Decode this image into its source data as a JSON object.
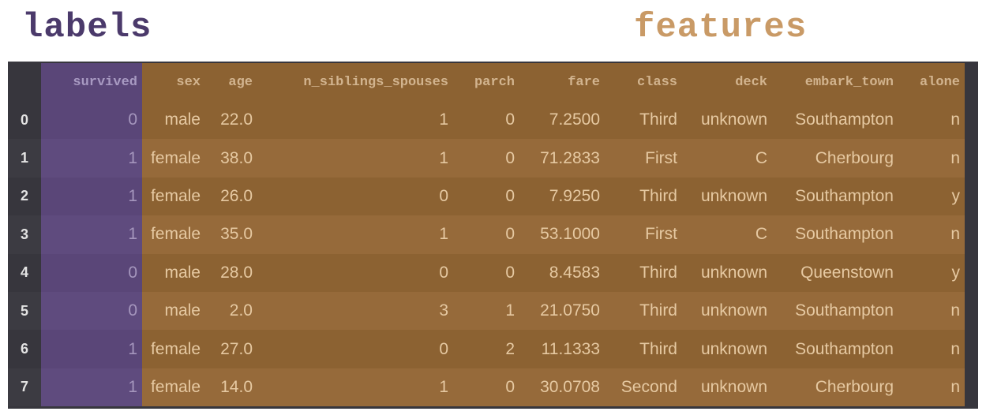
{
  "titles": {
    "labels": "labels",
    "features": "features"
  },
  "columns": {
    "index": "",
    "survived": "survived",
    "sex": "sex",
    "age": "age",
    "n_siblings_spouses": "n_siblings_spouses",
    "parch": "parch",
    "fare": "fare",
    "class": "class",
    "deck": "deck",
    "embark_town": "embark_town",
    "alone": "alone"
  },
  "rows": [
    {
      "index": "0",
      "survived": "0",
      "sex": "male",
      "age": "22.0",
      "n_siblings_spouses": "1",
      "parch": "0",
      "fare": "7.2500",
      "class": "Third",
      "deck": "unknown",
      "embark_town": "Southampton",
      "alone": "n"
    },
    {
      "index": "1",
      "survived": "1",
      "sex": "female",
      "age": "38.0",
      "n_siblings_spouses": "1",
      "parch": "0",
      "fare": "71.2833",
      "class": "First",
      "deck": "C",
      "embark_town": "Cherbourg",
      "alone": "n"
    },
    {
      "index": "2",
      "survived": "1",
      "sex": "female",
      "age": "26.0",
      "n_siblings_spouses": "0",
      "parch": "0",
      "fare": "7.9250",
      "class": "Third",
      "deck": "unknown",
      "embark_town": "Southampton",
      "alone": "y"
    },
    {
      "index": "3",
      "survived": "1",
      "sex": "female",
      "age": "35.0",
      "n_siblings_spouses": "1",
      "parch": "0",
      "fare": "53.1000",
      "class": "First",
      "deck": "C",
      "embark_town": "Southampton",
      "alone": "n"
    },
    {
      "index": "4",
      "survived": "0",
      "sex": "male",
      "age": "28.0",
      "n_siblings_spouses": "0",
      "parch": "0",
      "fare": "8.4583",
      "class": "Third",
      "deck": "unknown",
      "embark_town": "Queenstown",
      "alone": "y"
    },
    {
      "index": "5",
      "survived": "0",
      "sex": "male",
      "age": "2.0",
      "n_siblings_spouses": "3",
      "parch": "1",
      "fare": "21.0750",
      "class": "Third",
      "deck": "unknown",
      "embark_town": "Southampton",
      "alone": "n"
    },
    {
      "index": "6",
      "survived": "1",
      "sex": "female",
      "age": "27.0",
      "n_siblings_spouses": "0",
      "parch": "2",
      "fare": "11.1333",
      "class": "Third",
      "deck": "unknown",
      "embark_town": "Southampton",
      "alone": "n"
    },
    {
      "index": "7",
      "survived": "1",
      "sex": "female",
      "age": "14.0",
      "n_siblings_spouses": "1",
      "parch": "0",
      "fare": "30.0708",
      "class": "Second",
      "deck": "unknown",
      "embark_town": "Cherbourg",
      "alone": "n"
    }
  ],
  "colors": {
    "labels_title": "#4b3a6b",
    "features_title": "#c99a66",
    "labels_column": "#5a4678",
    "features_columns": "#8c6232",
    "index_column": "#37363d"
  }
}
